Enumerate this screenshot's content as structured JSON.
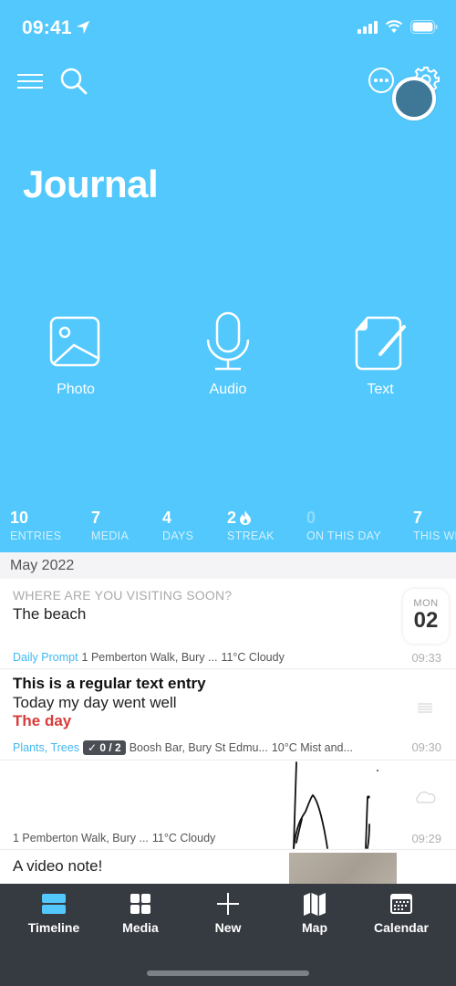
{
  "status_bar": {
    "time": "09:41",
    "icons": [
      "location-arrow-icon",
      "cellular-signal-icon",
      "wifi-icon",
      "battery-icon"
    ]
  },
  "toolbar": {
    "left_icons": [
      "menu-icon",
      "search-icon"
    ],
    "right_icons": [
      "more-icon",
      "gear-icon"
    ]
  },
  "header": {
    "title": "Journal"
  },
  "quick_actions": [
    {
      "label": "Photo",
      "icon": "photo-icon"
    },
    {
      "label": "Audio",
      "icon": "microphone-icon"
    },
    {
      "label": "Text",
      "icon": "document-edit-icon"
    }
  ],
  "stats": [
    {
      "value": "10",
      "label": "ENTRIES"
    },
    {
      "value": "7",
      "label": "MEDIA"
    },
    {
      "value": "4",
      "label": "DAYS"
    },
    {
      "value": "2",
      "label": "STREAK",
      "icon": "flame-icon"
    },
    {
      "value": "0",
      "label": "ON THIS DAY"
    },
    {
      "value": "7",
      "label": "THIS WE"
    }
  ],
  "timeline": {
    "month": "May 2022",
    "entries": [
      {
        "prompt": "WHERE ARE YOU VISITING SOON?",
        "body": "The beach",
        "tag": "Daily Prompt",
        "location": "1 Pemberton Walk, Bury ...",
        "weather": "11°C Cloudy",
        "time": "09:33",
        "date": {
          "dow": "MON",
          "day": "02"
        }
      },
      {
        "title": "This is a regular text entry",
        "body": "Today my day went well",
        "highlight": "The day",
        "tag": "Plants, Trees",
        "checklist": "✓ 0 / 2",
        "location": "Boosh Bar, Bury St Edmu...",
        "weather": "10°C Mist and...",
        "time": "09:30",
        "type_icon": "text-lines-icon"
      },
      {
        "location": "1 Pemberton Walk, Bury ...",
        "weather": "11°C Cloudy",
        "time": "09:29",
        "type_icon": "cloud-icon",
        "media": "sketch-thumbnail"
      },
      {
        "body": "A video note!",
        "media": "video-thumbnail"
      }
    ]
  },
  "tab_bar": {
    "active": "Timeline",
    "active_color": "#52c8fc",
    "tabs": [
      {
        "label": "Timeline",
        "icon": "timeline-icon"
      },
      {
        "label": "Media",
        "icon": "grid-icon"
      },
      {
        "label": "New",
        "icon": "plus-icon"
      },
      {
        "label": "Map",
        "icon": "map-icon"
      },
      {
        "label": "Calendar",
        "icon": "calendar-icon"
      }
    ]
  },
  "colors": {
    "brand": "#52c8fc",
    "tab_bar": "#363b42",
    "highlight_red": "#d83b3b",
    "avatar": "#3f7797"
  }
}
